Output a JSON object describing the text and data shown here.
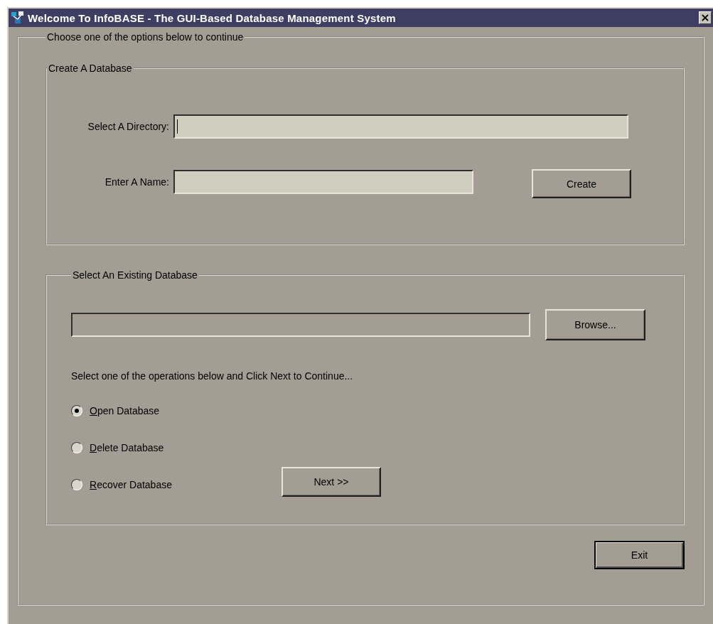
{
  "window": {
    "title": "Welcome To InfoBASE - The GUI-Based Database Management System",
    "close": "×"
  },
  "main_group": {
    "legend": "Choose one of the options below to continue"
  },
  "create_group": {
    "legend": "Create A Database",
    "fields": [
      {
        "label": "Select A Directory:",
        "focused": true
      },
      {
        "label": "Enter A Name:",
        "focused": false
      }
    ],
    "button": "Create"
  },
  "existing_group": {
    "legend": "Select An Existing Database",
    "button": "Browse...",
    "instruction": "Select one of the operations below and  Click Next to Continue...",
    "options": [
      {
        "label": "Open Database",
        "selected": true
      },
      {
        "label": "Delete Database",
        "selected": false
      },
      {
        "label": "Recover Database",
        "selected": false
      }
    ],
    "next_button": "Next >>"
  },
  "exit_button": "Exit"
}
